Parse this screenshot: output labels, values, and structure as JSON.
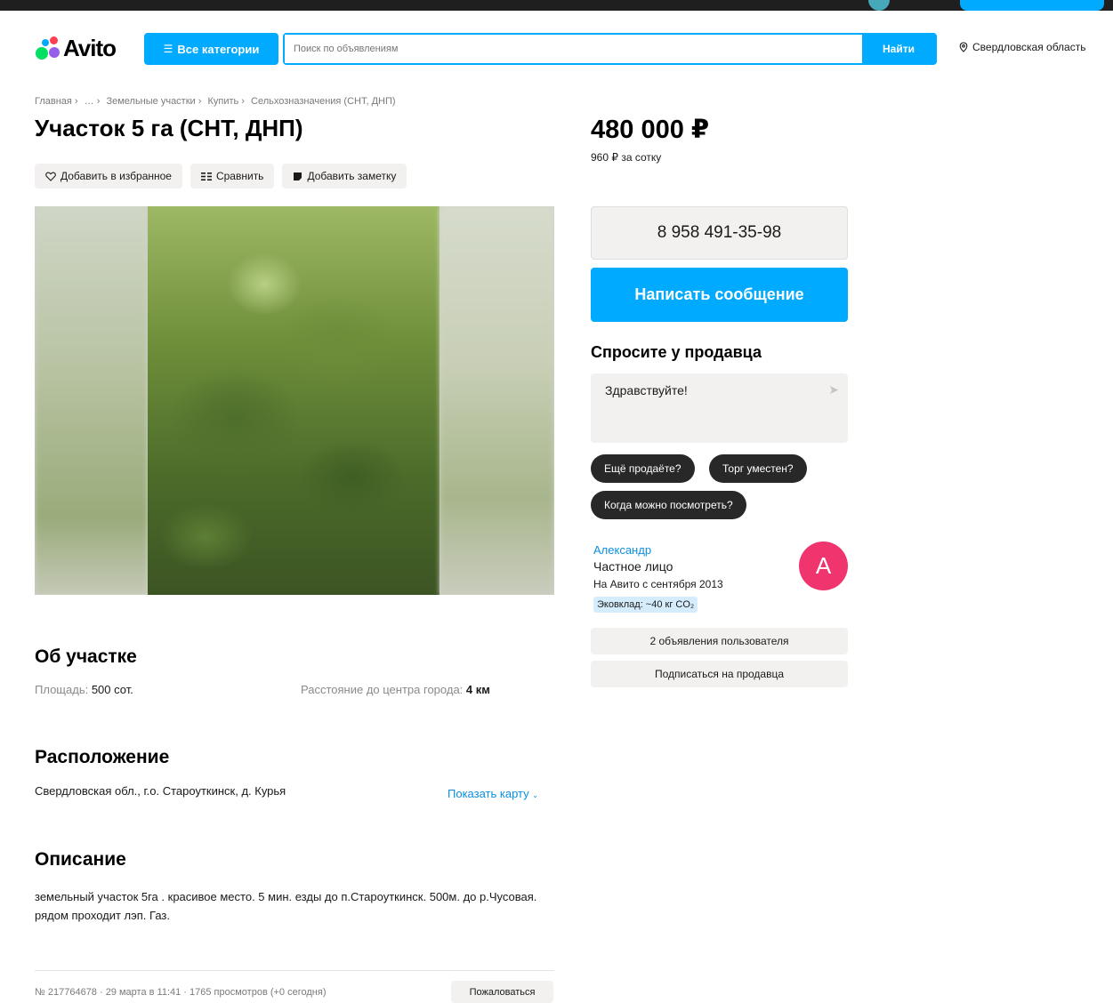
{
  "header": {
    "logo_text": "Avito",
    "categories_label": "Все категории",
    "search_placeholder": "Поиск по объявлениям",
    "search_button": "Найти",
    "region": "Свердловская область"
  },
  "breadcrumb": [
    "Главная ›",
    "… ›",
    "Земельные участки ›",
    "Купить ›",
    "Сельхозназначения (СНТ, ДНП)"
  ],
  "listing": {
    "title": "Участок 5 га (СНТ, ДНП)",
    "actions": {
      "favorite": "Добавить в избранное",
      "compare": "Сравнить",
      "note": "Добавить заметку"
    }
  },
  "about": {
    "title": "Об участке",
    "area_label": "Площадь:",
    "area_value": "500 сот.",
    "distance_label": "Расстояние до центра города:",
    "distance_value": "4 км"
  },
  "location": {
    "title": "Расположение",
    "address": "Свердловская обл., г.о. Староуткинск, д. Курья",
    "map_link": "Показать карту"
  },
  "description": {
    "title": "Описание",
    "text": "земельный участок 5га . красивое место. 5 мин. езды до п.Староуткинск. 500м. до р.Чусовая. рядом проходит лэп. Газ."
  },
  "footer": {
    "meta": "№ 217764678 · 29 марта в 11:41 · 1765 просмотров (+0 сегодня)",
    "complain": "Пожаловаться"
  },
  "sidebar": {
    "price": "480 000 ₽",
    "price_per": "960 ₽ за сотку",
    "phone": "8 958 491-35-98",
    "message_button": "Написать сообщение",
    "ask_title": "Спросите у продавца",
    "ask_text": "Здравствуйте!",
    "chips": [
      "Ещё продаёте?",
      "Торг уместен?",
      "Когда можно посмотреть?"
    ],
    "seller": {
      "name": "Александр",
      "type": "Частное лицо",
      "since": "На Авито с сентября 2013",
      "eco": "Эковклад: ~40 кг CO₂",
      "avatar_letter": "А"
    },
    "ads_button": "2 объявления пользователя",
    "subscribe_button": "Подписаться на продавца"
  },
  "colors": {
    "accent": "#00aaff",
    "avatar": "#f0346d",
    "chip": "#282828",
    "link": "#0a8fe0"
  },
  "icons": [
    "catalog-icon",
    "location-pin-icon",
    "heart-icon",
    "compare-icon",
    "note-icon",
    "send-icon",
    "chevron-down-icon"
  ]
}
